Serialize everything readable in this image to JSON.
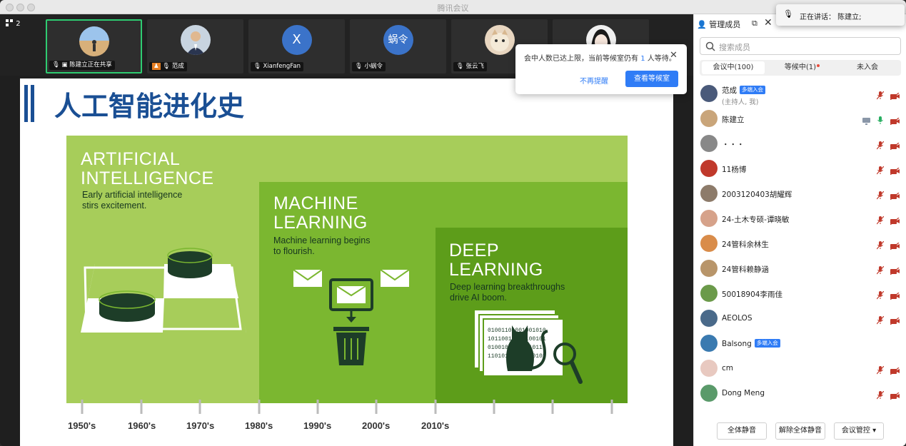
{
  "window": {
    "title": "腾讯会议"
  },
  "video_strip": {
    "participant_count": "2",
    "tiles": [
      {
        "name": "陈建立正在共享",
        "avatar": "photo-desert"
      },
      {
        "name": "范成",
        "avatar": "photo-man-suit"
      },
      {
        "name": "XianfengFan",
        "avatar_letter": "X"
      },
      {
        "name": "小蜗令",
        "avatar_letter": "蜗令"
      },
      {
        "name": "张云飞",
        "avatar": "photo-cat"
      },
      {
        "name": "",
        "avatar": "photo-anime"
      }
    ]
  },
  "slide": {
    "title": "人工智能进化史",
    "sections": [
      {
        "heading_1": "ARTIFICIAL",
        "heading_2": "INTELLIGENCE",
        "sub_1": "Early artificial intelligence",
        "sub_2": "stirs excitement."
      },
      {
        "heading_1": "MACHINE",
        "heading_2": "LEARNING",
        "sub_1": "Machine learning begins",
        "sub_2": "to flourish."
      },
      {
        "heading_1": "DEEP",
        "heading_2": "LEARNING",
        "sub_1": "Deep learning breakthroughs",
        "sub_2": "drive AI boom."
      }
    ],
    "decades": [
      "1950's",
      "1960's",
      "1970's",
      "1980's",
      "1990's",
      "2000's",
      "2010's"
    ],
    "colors": {
      "ai": "#a7cd5a",
      "ml": "#7bb730",
      "dl": "#5d9d1a",
      "dark": "#1d3d28",
      "title": "#1a4f94"
    }
  },
  "panel": {
    "title": "管理成员",
    "search_placeholder": "搜索成员",
    "tabs": {
      "in_meeting": "会议中(100)",
      "waiting": "等候中(1)",
      "not_joined": "未入会"
    },
    "members": [
      {
        "name": "范成",
        "badge": "多端入会",
        "sub": "(主持人, 我)",
        "avatar_color": "#4a5a7a",
        "screen": false,
        "mic": "muted",
        "cam": "off"
      },
      {
        "name": "陈建立",
        "badge": "",
        "sub": "",
        "avatar_color": "#c9a57a",
        "screen": true,
        "mic": "on",
        "cam": "off"
      },
      {
        "name": "・・・",
        "badge": "",
        "sub": "",
        "avatar_color": "#888888",
        "screen": false,
        "mic": "muted",
        "cam": "off"
      },
      {
        "name": "11杨博",
        "badge": "",
        "sub": "",
        "avatar_color": "#c0392b",
        "screen": false,
        "mic": "muted",
        "cam": "off"
      },
      {
        "name": "2003120403胡耀辉",
        "badge": "",
        "sub": "",
        "avatar_color": "#8d7b6a",
        "screen": false,
        "mic": "muted",
        "cam": "off"
      },
      {
        "name": "24-土木专硕-谭晓敏",
        "badge": "",
        "sub": "",
        "avatar_color": "#d6a28a",
        "screen": false,
        "mic": "muted",
        "cam": "off"
      },
      {
        "name": "24管科余林生",
        "badge": "",
        "sub": "",
        "avatar_color": "#d98c4a",
        "screen": false,
        "mic": "muted",
        "cam": "off"
      },
      {
        "name": "24管科赖静涵",
        "badge": "",
        "sub": "",
        "avatar_color": "#b8956a",
        "screen": false,
        "mic": "muted",
        "cam": "off"
      },
      {
        "name": "50018904李雨佳",
        "badge": "",
        "sub": "",
        "avatar_color": "#6b9a4a",
        "screen": false,
        "mic": "muted",
        "cam": "off"
      },
      {
        "name": "AEOLOS",
        "badge": "",
        "sub": "",
        "avatar_color": "#4a6a8a",
        "screen": false,
        "mic": "muted",
        "cam": "off"
      },
      {
        "name": "Balsong",
        "badge": "多端入会",
        "sub": "",
        "avatar_color": "#3a7ab0",
        "screen": false,
        "mic": "",
        "cam": ""
      },
      {
        "name": "cm",
        "badge": "",
        "sub": "",
        "avatar_color": "#e8c9c0",
        "screen": false,
        "mic": "muted",
        "cam": "off"
      },
      {
        "name": "Dong Meng",
        "badge": "",
        "sub": "",
        "avatar_color": "#5a9a6a",
        "screen": false,
        "mic": "muted",
        "cam": "off"
      }
    ],
    "footer": {
      "mute_all": "全体静音",
      "unmute_all": "解除全体静音",
      "controls": "会议管控"
    }
  },
  "waiting_popup": {
    "message_1": "会中人数已达上限，当前等候室仍有",
    "count": "1",
    "message_2": "人等待。",
    "dismiss": "不再提醒",
    "view": "查看等候室"
  },
  "speaking_popup": {
    "text": "正在讲话： 陈建立;"
  }
}
